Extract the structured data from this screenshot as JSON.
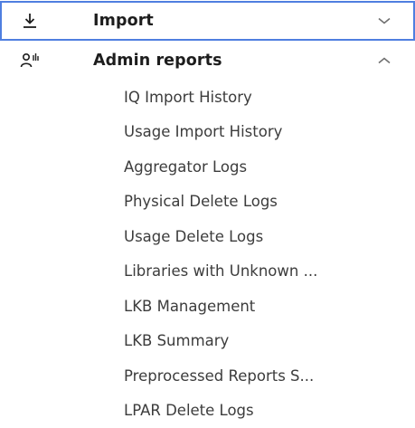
{
  "nav": {
    "import": {
      "label": "Import",
      "icon": "download-icon",
      "state": "collapsed"
    },
    "admin_reports": {
      "label": "Admin reports",
      "icon": "user-admin-icon",
      "state": "expanded",
      "items": [
        {
          "label": "IQ Import History"
        },
        {
          "label": "Usage Import History"
        },
        {
          "label": "Aggregator Logs"
        },
        {
          "label": "Physical Delete Logs"
        },
        {
          "label": "Usage Delete Logs"
        },
        {
          "label": "Libraries with Unknown ..."
        },
        {
          "label": "LKB Management"
        },
        {
          "label": "LKB Summary"
        },
        {
          "label": "Preprocessed Reports S..."
        },
        {
          "label": "LPAR Delete Logs"
        }
      ]
    }
  },
  "colors": {
    "focus_border": "#4f7fe0",
    "heading_text": "#1d1d1d",
    "item_text": "#3c3c3c"
  }
}
